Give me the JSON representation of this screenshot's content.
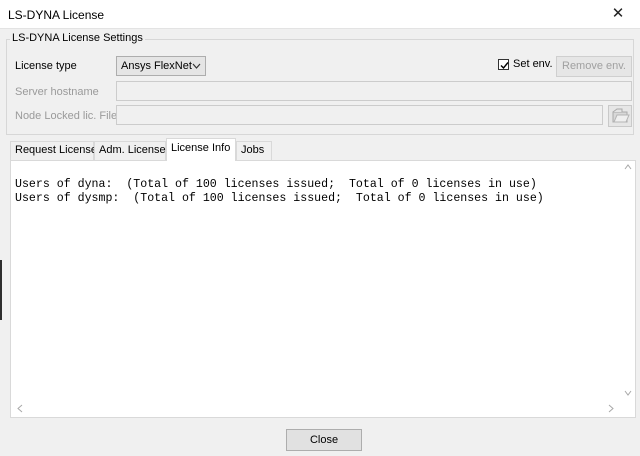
{
  "window": {
    "title": "LS-DYNA License",
    "close_glyph": "✕"
  },
  "settings": {
    "group_title": "LS-DYNA License Settings",
    "license_type_label": "License type",
    "license_type_value": "Ansys FlexNet",
    "set_env_label": "Set env.",
    "set_env_checked": true,
    "remove_env_label": "Remove env.",
    "server_hostname_label": "Server hostname",
    "server_hostname_value": "",
    "node_locked_label": "Node Locked lic. File",
    "node_locked_value": ""
  },
  "tabs": [
    {
      "label": "Request License",
      "active": false
    },
    {
      "label": "Adm. License",
      "active": false
    },
    {
      "label": "License Info",
      "active": true
    },
    {
      "label": "Jobs",
      "active": false
    }
  ],
  "license_info": {
    "lines": [
      "Users of dyna:  (Total of 100 licenses issued;  Total of 0 licenses in use)",
      "Users of dysmp:  (Total of 100 licenses issued;  Total of 0 licenses in use)"
    ]
  },
  "footer": {
    "close_label": "Close"
  },
  "icons": {
    "folder": "folder-open-icon",
    "scroll_up": "‸",
    "scroll_left": "<",
    "scroll_right": ">",
    "scroll_down": "⌄"
  }
}
